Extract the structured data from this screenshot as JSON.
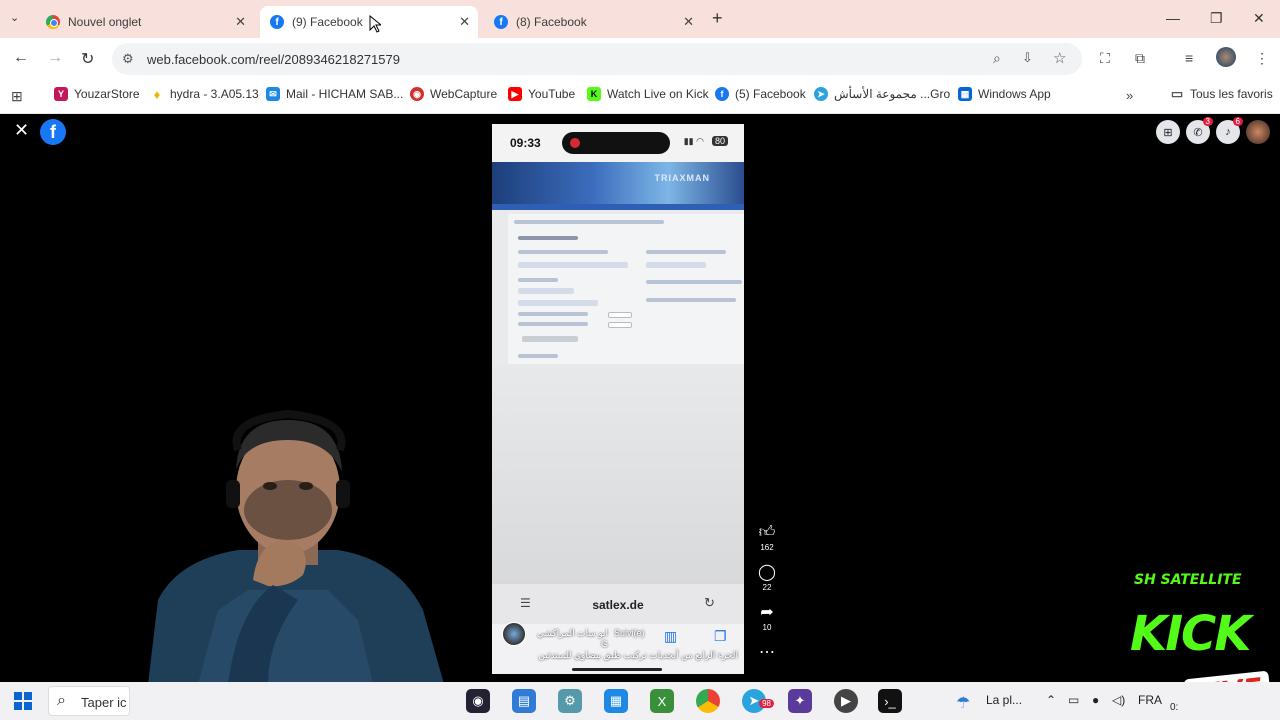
{
  "browser": {
    "tabs": [
      {
        "title": "Nouvel onglet",
        "active": false
      },
      {
        "title": "(9) Facebook",
        "active": true
      },
      {
        "title": "(8) Facebook",
        "active": false
      }
    ],
    "url": "web.facebook.com/reel/2089346218271579",
    "bookmarks": [
      {
        "label": "YouzarStore",
        "icon": "youzar-icon",
        "color": "#c2185b"
      },
      {
        "label": "hydra - 3.A05.13",
        "icon": "lightbulb-icon",
        "color": "#f4b400"
      },
      {
        "label": "Mail - HICHAM SAB...",
        "icon": "mail-icon",
        "color": "#1e88e5"
      },
      {
        "label": "WebCapture",
        "icon": "webcapture-icon",
        "color": "#d32f2f"
      },
      {
        "label": "YouTube",
        "icon": "youtube-icon",
        "color": "#ff0000"
      },
      {
        "label": "Watch Live on Kick",
        "icon": "kick-icon",
        "color": "#53fc18"
      },
      {
        "label": "(5) Facebook",
        "icon": "facebook-icon",
        "color": "#1877f2"
      },
      {
        "label": "مجموعة الأسأش ...Gro",
        "icon": "telegram-icon",
        "color": "#2aa3df"
      },
      {
        "label": "Windows App",
        "icon": "windows-icon",
        "color": "#0a64d2"
      }
    ],
    "all_bookmarks_label": "Tous les favoris"
  },
  "reel": {
    "phone": {
      "time": "09:33",
      "battery": "80",
      "banner_text": "TRIAXMAN",
      "site": "satlex.de"
    },
    "author": "ابو سات المراكشي G",
    "follow_label": "Suivi(e)",
    "caption": "الجزء الرابع من أبجديات تركيب طبق بيضاوي للمبتدئين",
    "likes": "162",
    "comments": "22",
    "shares": "10",
    "notifications": {
      "messenger": "3",
      "alerts": "6"
    }
  },
  "overlay": {
    "kick_sh": "SH SATELLITE",
    "kick_word": "KICK",
    "kick_live": "LIVE"
  },
  "taskbar": {
    "search_placeholder": "Taper ic",
    "weather": "La pl...",
    "language": "FRA",
    "clock": "0:",
    "telegram_badge": "98"
  }
}
